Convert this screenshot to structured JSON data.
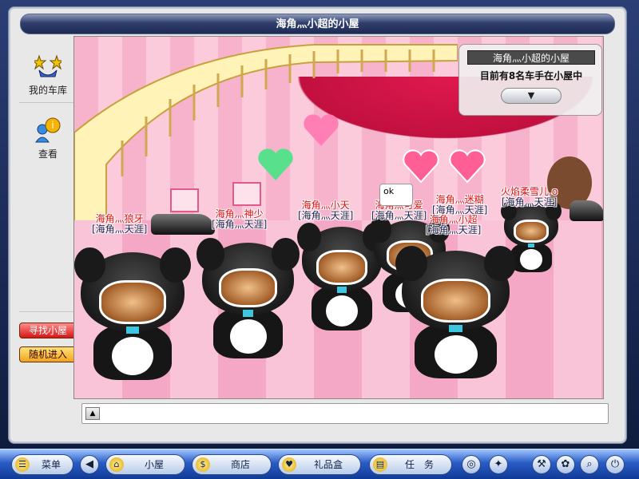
{
  "window": {
    "title": "海角灬小超的小屋"
  },
  "sidebar": {
    "garage_label": "我的车库",
    "view_label": "查看",
    "find_house_label": "寻找小屋",
    "random_enter_label": "随机进入"
  },
  "info_panel": {
    "title": "海角灬小超的小屋",
    "count_text": "目前有8名车手在小屋中",
    "expand_icon": "▼"
  },
  "players": [
    {
      "name": "海角灬狼牙",
      "team": "[海角灬天涯]"
    },
    {
      "name": "海角灬神少",
      "team": "[海角灬天涯]"
    },
    {
      "name": "海角灬小天",
      "team": "[海角灬天涯]"
    },
    {
      "name": "海角灬可爱",
      "team": "[海角灬天涯]"
    },
    {
      "name": "海角灬迷糊",
      "team": "[海角灬天涯]"
    },
    {
      "name": "海角灬小超",
      "team": "[海角灬天涯]"
    },
    {
      "name": "火焰柔雪儿.o",
      "team": "[海角灬天涯]"
    }
  ],
  "chat": {
    "bubble_text": "ok",
    "input_value": "",
    "toggle_icon": "▲"
  },
  "taskbar": {
    "menu_label": "菜单",
    "house_label": "小屋",
    "shop_label": "商店",
    "gift_label": "礼品盒",
    "task_label": "任　务",
    "icons": [
      "back-icon",
      "compass-icon",
      "magic-icon",
      "tools-icon",
      "settings-icon",
      "search-icon",
      "power-icon"
    ]
  },
  "colors": {
    "name_red": "#e01010",
    "find_btn": "#d51515",
    "random_btn": "#f0a41c",
    "taskbar_blue": "#2a5cc4"
  }
}
